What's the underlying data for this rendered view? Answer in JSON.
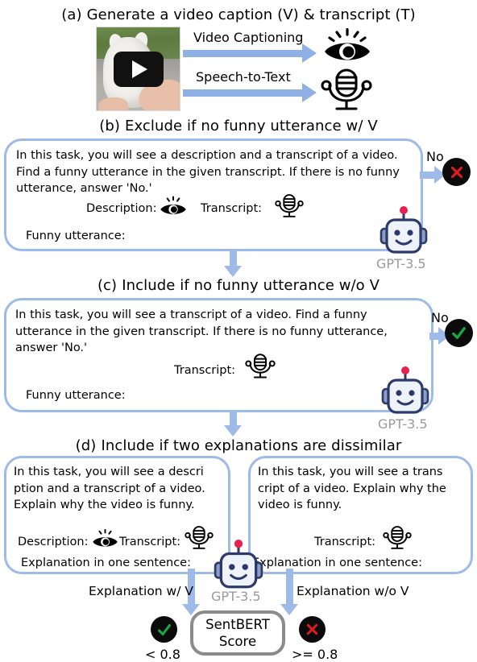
{
  "figure": {
    "sections": [
      {
        "tag": "(a)",
        "title": "Generate a video caption (V)  & transcript (T)"
      },
      {
        "tag": "(b)",
        "title": "Exclude if no funny utterance w/  V"
      },
      {
        "tag": "(c)",
        "title": "Include if no funny utterance w/o  V"
      },
      {
        "tag": "(d)",
        "title": "Include if two explanations are dissimilar"
      }
    ]
  },
  "panel_a": {
    "arrow_labels": [
      "Video Captioning",
      "Speech-to-Text"
    ],
    "icons": [
      "eye-icon",
      "microphone-icon"
    ],
    "thumbnail_alt": "video-thumbnail-dog",
    "play_icon": "play-icon"
  },
  "panel_b": {
    "prompt": "In this task, you will see a description and a transcript of a video. Find a funny utterance in the given transcript. If there is no funny utterance, answer 'No.'",
    "description_label": "Description:",
    "transcript_label": "Transcript:",
    "answer_field_label": "Funny utterance:",
    "output_label": "No",
    "verdict": "exclude",
    "verdict_icon": "cross-icon",
    "model_label": "GPT-3.5"
  },
  "panel_c": {
    "prompt": "In this task, you will see a transcript of a video. Find a funny utterance in the given transcript. If there is no funny utterance, answer 'No.'",
    "transcript_label": "Transcript:",
    "answer_field_label": "Funny utterance:",
    "output_label": "No",
    "verdict": "include",
    "verdict_icon": "check-icon",
    "model_label": "GPT-3.5"
  },
  "panel_d": {
    "left": {
      "prompt": "In this task, you will see a descri ption and a transcript of a video. Explain why the video is funny.",
      "description_label": "Description:",
      "transcript_label": "Transcript:",
      "answer_field_label": "Explanation in one sentence:"
    },
    "right": {
      "prompt": "In this task, you will see a trans cript of a video. Explain why the video is funny.",
      "transcript_label": "Transcript:",
      "answer_field_label": "Explanation in one sentence:"
    },
    "model_label": "GPT-3.5",
    "branch_left_label": "Explanation w/ V",
    "branch_right_label": "Explanation w/o V",
    "scorer": "SentBERT\nScore",
    "scorer_line1": "SentBERT",
    "scorer_line2": "Score",
    "threshold_left": "< 0.8",
    "threshold_right": ">= 0.8",
    "left_icon": "check-icon",
    "right_icon": "cross-icon"
  },
  "colors": {
    "border_blue": "#9DBAE8",
    "arrow_blue": "#8FB0E4",
    "badge_bg": "#0b0b0b",
    "check_green": "#17a84a",
    "cross_red": "#e01b1b",
    "gray_label": "#9a9a9a",
    "sentbox_border": "#8b8b8b"
  }
}
